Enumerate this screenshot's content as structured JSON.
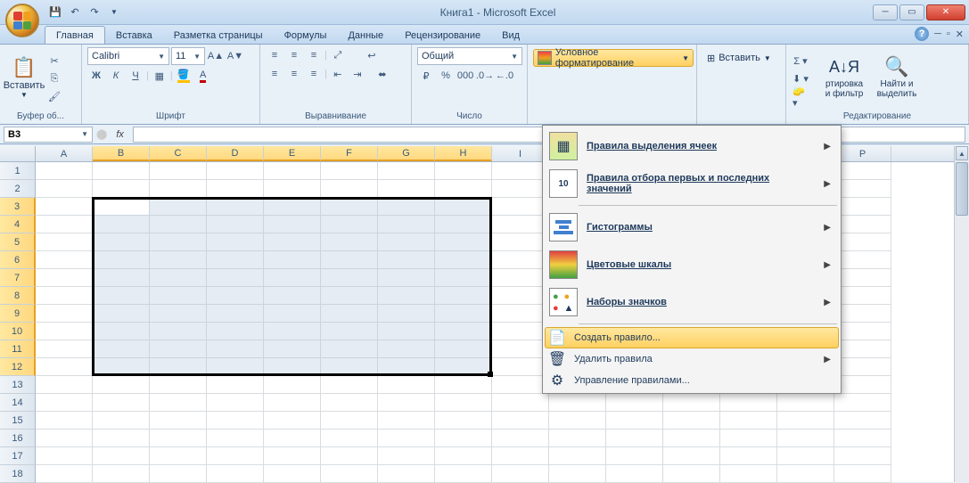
{
  "title": "Книга1 - Microsoft Excel",
  "qat": {
    "save": "💾",
    "undo": "↶",
    "redo": "↷"
  },
  "tabs": [
    "Главная",
    "Вставка",
    "Разметка страницы",
    "Формулы",
    "Данные",
    "Рецензирование",
    "Вид"
  ],
  "active_tab": 0,
  "ribbon": {
    "clipboard": {
      "label": "Буфер об...",
      "paste": "Вставить"
    },
    "font": {
      "label": "Шрифт",
      "name": "Calibri",
      "size": "11",
      "bold": "Ж",
      "italic": "К",
      "underline": "Ч"
    },
    "alignment": {
      "label": "Выравнивание"
    },
    "number": {
      "label": "Число",
      "format": "Общий"
    },
    "styles": {
      "cond_format": "Условное форматирование"
    },
    "cells": {
      "insert": "Вставить"
    },
    "editing": {
      "label": "Редактирование",
      "sort": "ртировка\nи фильтр",
      "find": "Найти и\nвыделить"
    }
  },
  "formula": {
    "cell_ref": "B3",
    "fx": "fx"
  },
  "columns": [
    "A",
    "B",
    "C",
    "D",
    "E",
    "F",
    "G",
    "H",
    "I",
    "",
    "",
    "",
    "",
    "O",
    "P"
  ],
  "selected_cols": [
    "B",
    "C",
    "D",
    "E",
    "F",
    "G",
    "H"
  ],
  "rows": [
    1,
    2,
    3,
    4,
    5,
    6,
    7,
    8,
    9,
    10,
    11,
    12,
    13,
    14,
    15,
    16,
    17,
    18
  ],
  "selected_rows": [
    3,
    4,
    5,
    6,
    7,
    8,
    9,
    10,
    11,
    12
  ],
  "dropdown": {
    "highlight_rules": "Правила выделения ячеек",
    "top_bottom": "Правила отбора первых и последних значений",
    "data_bars": "Гистограммы",
    "color_scales": "Цветовые шкалы",
    "icon_sets": "Наборы значков",
    "new_rule": "Создать правило...",
    "clear_rules": "Удалить правила",
    "manage_rules": "Управление правилами..."
  }
}
